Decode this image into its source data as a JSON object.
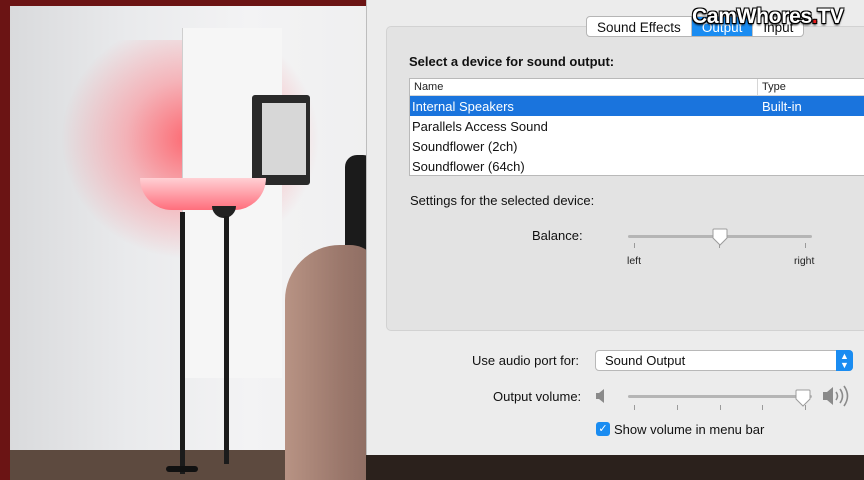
{
  "watermark": {
    "main": "CamWhores",
    "dot": ".",
    "tld": "TV"
  },
  "tabs": [
    {
      "label": "Sound Effects",
      "active": false
    },
    {
      "label": "Output",
      "active": true
    },
    {
      "label": "Input",
      "active": false
    }
  ],
  "output": {
    "heading": "Select a device for sound output:",
    "columns": {
      "name": "Name",
      "type": "Type"
    },
    "devices": [
      {
        "name": "Internal Speakers",
        "type": "Built-in",
        "selected": true
      },
      {
        "name": "Parallels Access Sound",
        "type": ""
      },
      {
        "name": "Soundflower (2ch)",
        "type": ""
      },
      {
        "name": "Soundflower (64ch)",
        "type": ""
      }
    ],
    "settings_label": "Settings for the selected device:",
    "balance": {
      "label": "Balance:",
      "left": "left",
      "right": "right",
      "value": 0.5
    }
  },
  "audio_port": {
    "label": "Use audio port for:",
    "value": "Sound Output"
  },
  "volume": {
    "label": "Output volume:",
    "value": 0.95
  },
  "menu_bar": {
    "label": "Show volume in menu bar",
    "checked": true
  },
  "colors": {
    "accent": "#1a8cf1",
    "selection": "#1a74dd",
    "watermark_dot": "#e41b1b"
  },
  "icons": {
    "mute": "speaker-low-icon",
    "loud": "speaker-high-icon",
    "check": "checkmark-icon",
    "stepper": "chevron-updown-icon"
  }
}
